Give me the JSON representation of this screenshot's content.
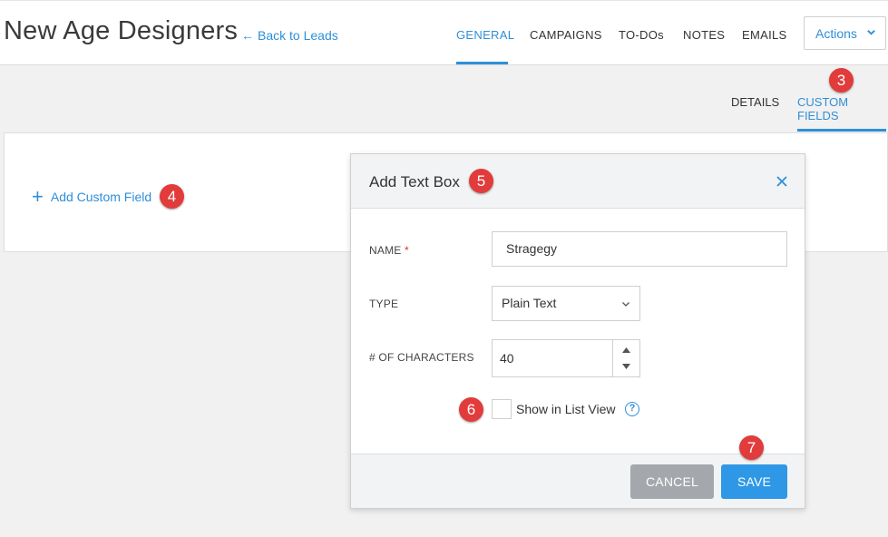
{
  "header": {
    "title": "New Age Designers",
    "back_label": "Back to Leads",
    "tabs": [
      {
        "label": "GENERAL"
      },
      {
        "label": "CAMPAIGNS"
      },
      {
        "label": "TO-DOs"
      },
      {
        "label": "NOTES"
      },
      {
        "label": "EMAILS"
      }
    ],
    "actions_label": "Actions"
  },
  "subtabs": [
    {
      "label": "DETAILS"
    },
    {
      "label": "CUSTOM FIELDS"
    }
  ],
  "panel": {
    "add_label": "Add Custom Field"
  },
  "modal": {
    "title": "Add Text Box",
    "name_label": "NAME",
    "name_required": "*",
    "name_value": "Stragegy",
    "type_label": "TYPE",
    "type_value": "Plain Text",
    "chars_label": "# OF CHARACTERS",
    "chars_value": "40",
    "show_list_label": "Show in List View",
    "show_list_checked": false,
    "help_glyph": "?",
    "cancel_label": "CANCEL",
    "save_label": "SAVE"
  },
  "markers": [
    "3",
    "4",
    "5",
    "6",
    "7"
  ],
  "colors": {
    "accent": "#2e8fd8",
    "marker": "#e23b3b",
    "save": "#2f98e6",
    "cancel": "#a4a8ac"
  }
}
